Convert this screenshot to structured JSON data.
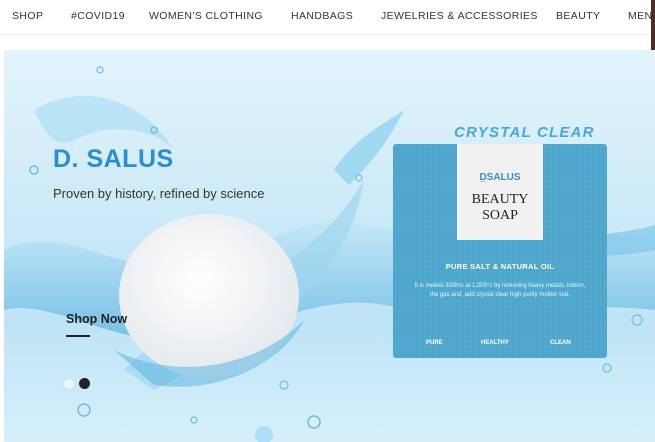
{
  "nav": {
    "items": [
      "SHOP",
      "#COVID19",
      "WOMEN'S CLOTHING",
      "HANDBAGS",
      "JEWELRIES & ACCESSORIES",
      "BEAUTY",
      "MEN"
    ]
  },
  "hero": {
    "brand": "D. SALUS",
    "tagline": "Proven by history, refined by science",
    "shop_now": "Shop Now",
    "slide_count": 2,
    "active_slide": 2
  },
  "product": {
    "badge": "CRYSTAL CLEAR",
    "label_brand": "D̲SALUS",
    "label_line1": "BEAUTY",
    "label_line2": "SOAP",
    "subtitle": "PURE SALT & NATURAL OIL",
    "description": "It is melted 300hrs at 1,000°c by removing heavy metals, bittern, the gas and, add crystal clear high purity molten slat.",
    "tags": [
      "PURE",
      "HEALTHY",
      "CLEAN"
    ]
  },
  "colors": {
    "brand": "#2a8fd0",
    "box": "#4ea6cc",
    "accent": "#46a7e0"
  }
}
